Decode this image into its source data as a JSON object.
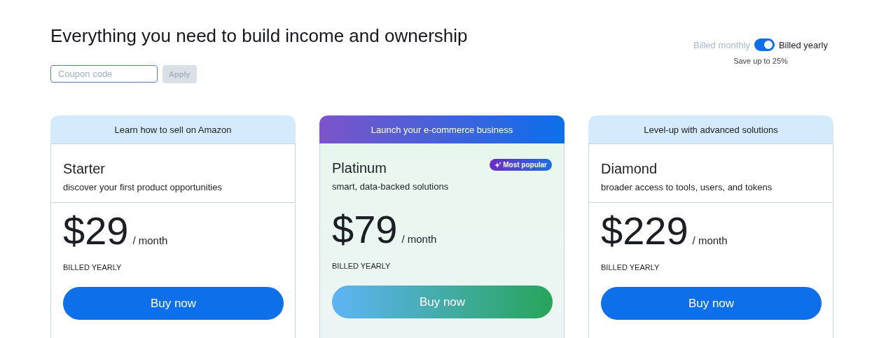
{
  "heading": "Everything you need to build income and ownership",
  "coupon": {
    "placeholder": "Coupon code",
    "button": "Apply",
    "disabled": true
  },
  "billing": {
    "options": [
      {
        "label": "Billed monthly",
        "selected": false
      },
      {
        "label": "Billed yearly",
        "selected": true
      }
    ],
    "note": "Save up to 25%"
  },
  "plans": [
    {
      "kind": "standard",
      "tagline": "Learn how to sell on Amazon",
      "name": "Starter",
      "description": "discover your first product opportunities",
      "price": "$29",
      "period": "/ month",
      "billing": "BILLED YEARLY",
      "button": "Buy now"
    },
    {
      "kind": "featured",
      "tagline": "Launch your e-commerce business",
      "name": "Platinum",
      "badge": "Most popular",
      "description": "smart, data-backed solutions",
      "price": "$79",
      "period": "/ month",
      "billing": "BILLED YEARLY",
      "button": "Buy now"
    },
    {
      "kind": "standard",
      "tagline": "Level-up with advanced solutions",
      "name": "Diamond",
      "description": "broader access to tools, users, and tokens",
      "price": "$229",
      "period": "/ month",
      "billing": "BILLED YEARLY",
      "button": "Buy now"
    }
  ]
}
